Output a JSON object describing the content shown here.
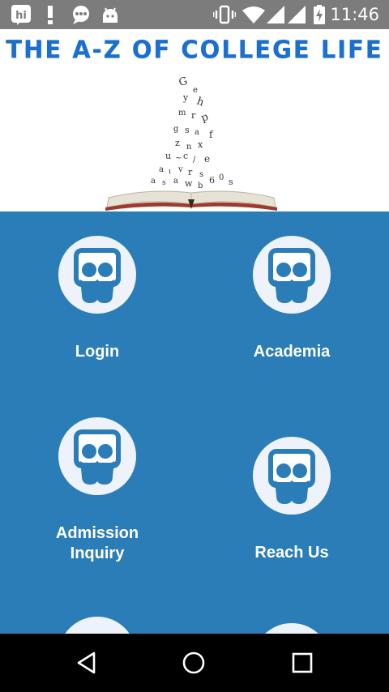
{
  "status_bar": {
    "time": "11:46",
    "icons": [
      "hike-icon",
      "alert-icon",
      "chat-icon",
      "android-debug-icon",
      "vibrate-icon",
      "wifi-icon",
      "signal-icon",
      "signal-icon",
      "battery-charging-icon"
    ]
  },
  "banner": {
    "title": "THE A-Z OF COLLEGE LIFE",
    "hike_badge": "hi"
  },
  "tiles": [
    {
      "label": "Login",
      "icon": "slideshare-icon"
    },
    {
      "label": "Academia",
      "icon": "slideshare-icon"
    },
    {
      "label": "Admission\nInquiry",
      "icon": "slideshare-icon"
    },
    {
      "label": "Reach Us",
      "icon": "slideshare-icon"
    }
  ],
  "nav": [
    "back-icon",
    "home-icon",
    "recents-icon"
  ],
  "colors": {
    "grid_bg": "#2b7db7",
    "title_blue": "#1b6fd0",
    "status_bg": "#7c7c7c"
  }
}
